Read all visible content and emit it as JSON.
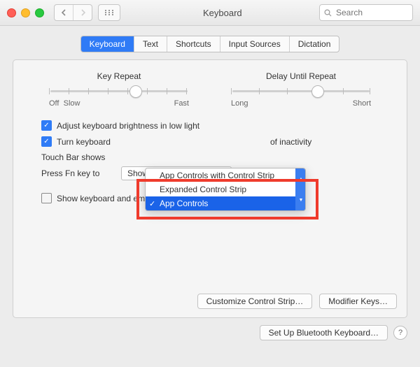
{
  "window": {
    "title": "Keyboard",
    "search_placeholder": "Search"
  },
  "tabs": [
    {
      "label": "Keyboard",
      "active": true
    },
    {
      "label": "Text",
      "active": false
    },
    {
      "label": "Shortcuts",
      "active": false
    },
    {
      "label": "Input Sources",
      "active": false
    },
    {
      "label": "Dictation",
      "active": false
    }
  ],
  "sliders": {
    "key_repeat": {
      "title": "Key Repeat",
      "left_label": "Off",
      "left_label2": "Slow",
      "right_label": "Fast",
      "value_pct": 62
    },
    "delay_until_repeat": {
      "title": "Delay Until Repeat",
      "left_label": "Long",
      "right_label": "Short",
      "value_pct": 62
    }
  },
  "checkboxes": {
    "adjust_brightness": {
      "checked": true,
      "label": "Adjust keyboard brightness in low light"
    },
    "turn_off_backlight": {
      "checked": true,
      "label_before": "Turn keyboard",
      "label_after": "of inactivity"
    },
    "show_viewers": {
      "checked": false,
      "label": "Show keyboard and emoji viewers in menu bar"
    }
  },
  "touch_bar": {
    "label": "Touch Bar shows",
    "selected": "App Controls",
    "options": [
      "App Controls with Control Strip",
      "Expanded Control Strip",
      "App Controls"
    ]
  },
  "fn_key": {
    "label": "Press Fn key to",
    "selected": "Show F1, F2, etc. Keys"
  },
  "buttons": {
    "customize": "Customize Control Strip…",
    "modifier": "Modifier Keys…",
    "bluetooth": "Set Up Bluetooth Keyboard…"
  }
}
